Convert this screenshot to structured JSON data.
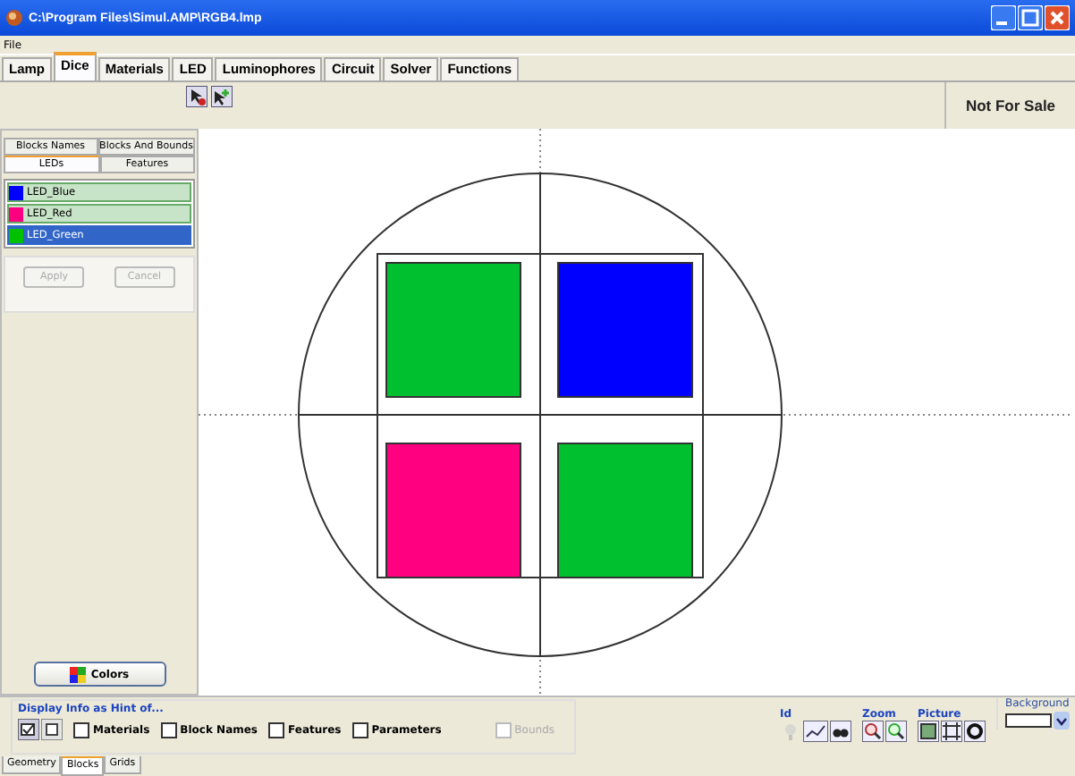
{
  "window": {
    "title": "C:\\Program Files\\Simul.AMP\\RGB4.lmp"
  },
  "menu": [
    "File"
  ],
  "tabs": [
    {
      "label": "Lamp",
      "selected": false
    },
    {
      "label": "Dice",
      "selected": true
    },
    {
      "label": "Materials",
      "selected": false
    },
    {
      "label": "LED",
      "selected": false
    },
    {
      "label": "Luminophores",
      "selected": false
    },
    {
      "label": "Circuit",
      "selected": false
    },
    {
      "label": "Solver",
      "selected": false
    },
    {
      "label": "Functions",
      "selected": false
    }
  ],
  "notice": "Not For Sale",
  "side_tabs": [
    [
      {
        "label": "Blocks Names",
        "selected": false
      },
      {
        "label": "Blocks And Bounds",
        "selected": false
      }
    ],
    [
      {
        "label": "LEDs",
        "selected": true
      },
      {
        "label": "Features",
        "selected": false
      }
    ]
  ],
  "leds": [
    {
      "name": "LED_Blue",
      "color": "#0000ff",
      "selected": false
    },
    {
      "name": "LED_Red",
      "color": "#ff0080",
      "selected": false
    },
    {
      "name": "LED_Green",
      "color": "#00c000",
      "selected": true
    }
  ],
  "buttons": [
    {
      "label": "Apply",
      "disabled": true
    },
    {
      "label": "Cancel",
      "disabled": true
    }
  ],
  "colors_button": "Colors",
  "blocks": [
    {
      "color": "#00c030"
    },
    {
      "color": "#0000ff"
    },
    {
      "color": "#ff0080"
    },
    {
      "color": "#00c030"
    }
  ],
  "hint": {
    "title": "Display Info as Hint of...",
    "options": [
      {
        "label": "Materials",
        "checked": false,
        "disabled": false
      },
      {
        "label": "Block Names",
        "checked": false,
        "disabled": false
      },
      {
        "label": "Features",
        "checked": false,
        "disabled": false
      },
      {
        "label": "Parameters",
        "checked": false,
        "disabled": false
      },
      {
        "label": "Bounds",
        "checked": false,
        "disabled": true
      }
    ]
  },
  "groups": [
    "Id",
    "Zoom",
    "Picture"
  ],
  "background_label": "Background",
  "bottom_tabs": [
    {
      "label": "Geometry",
      "selected": false
    },
    {
      "label": "Blocks",
      "selected": true
    },
    {
      "label": "Grids",
      "selected": false
    }
  ]
}
